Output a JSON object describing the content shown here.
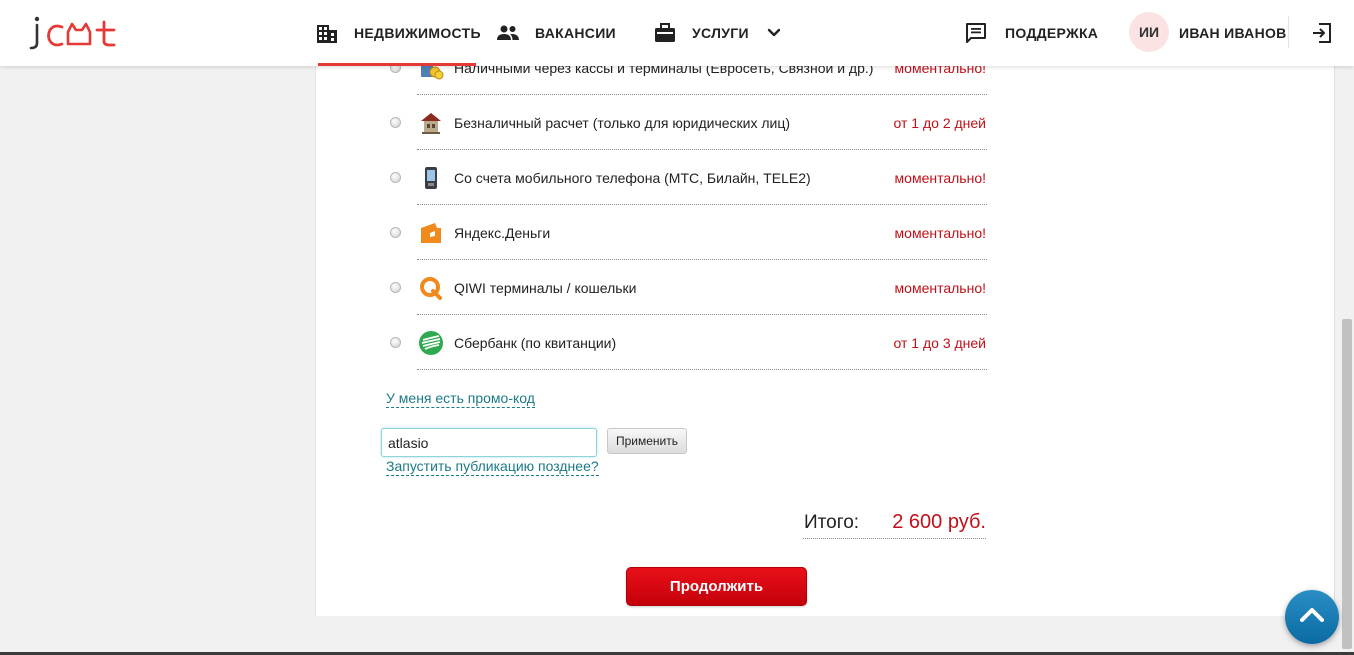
{
  "header": {
    "logo_text": "jcat",
    "nav": [
      {
        "label": "НЕДВИЖИМОСТЬ",
        "icon": "building-icon"
      },
      {
        "label": "ВАКАНСИИ",
        "icon": "people-icon"
      },
      {
        "label": "УСЛУГИ",
        "icon": "briefcase-icon"
      }
    ],
    "support_label": "ПОДДЕРЖКА",
    "user_initials": "ИИ",
    "user_name": "ИВАН ИВАНОВ"
  },
  "payment_methods": [
    {
      "label": "Наличными через кассы и терминалы (Евросеть, Связной и др.)",
      "time": "моментально!",
      "icon": "cash-terminal-icon"
    },
    {
      "label": "Безналичный расчет (только для юридических лиц)",
      "time": "от 1 до 2 дней",
      "icon": "bank-building-icon"
    },
    {
      "label": "Со счета мобильного телефона (МТС, Билайн, TELE2)",
      "time": "моментально!",
      "icon": "mobile-phone-icon"
    },
    {
      "label": "Яндекс.Деньги",
      "time": "моментально!",
      "icon": "yandex-money-icon"
    },
    {
      "label": "QIWI терминалы / кошельки",
      "time": "моментально!",
      "icon": "qiwi-icon"
    },
    {
      "label": "Сбербанк (по квитанции)",
      "time": "от 1 до 3 дней",
      "icon": "sberbank-icon"
    }
  ],
  "promo": {
    "link_label": "У меня есть промо-код",
    "input_value": "atlasio",
    "apply_label": "Применить",
    "later_label": "Запустить публикацию позднее?"
  },
  "total": {
    "label": "Итого:",
    "value": "2 600 руб."
  },
  "continue_label": "Продолжить",
  "colors": {
    "accent_red": "#c0101a",
    "link_teal": "#1c7a86",
    "scroll_top_blue": "#1a7db5"
  }
}
